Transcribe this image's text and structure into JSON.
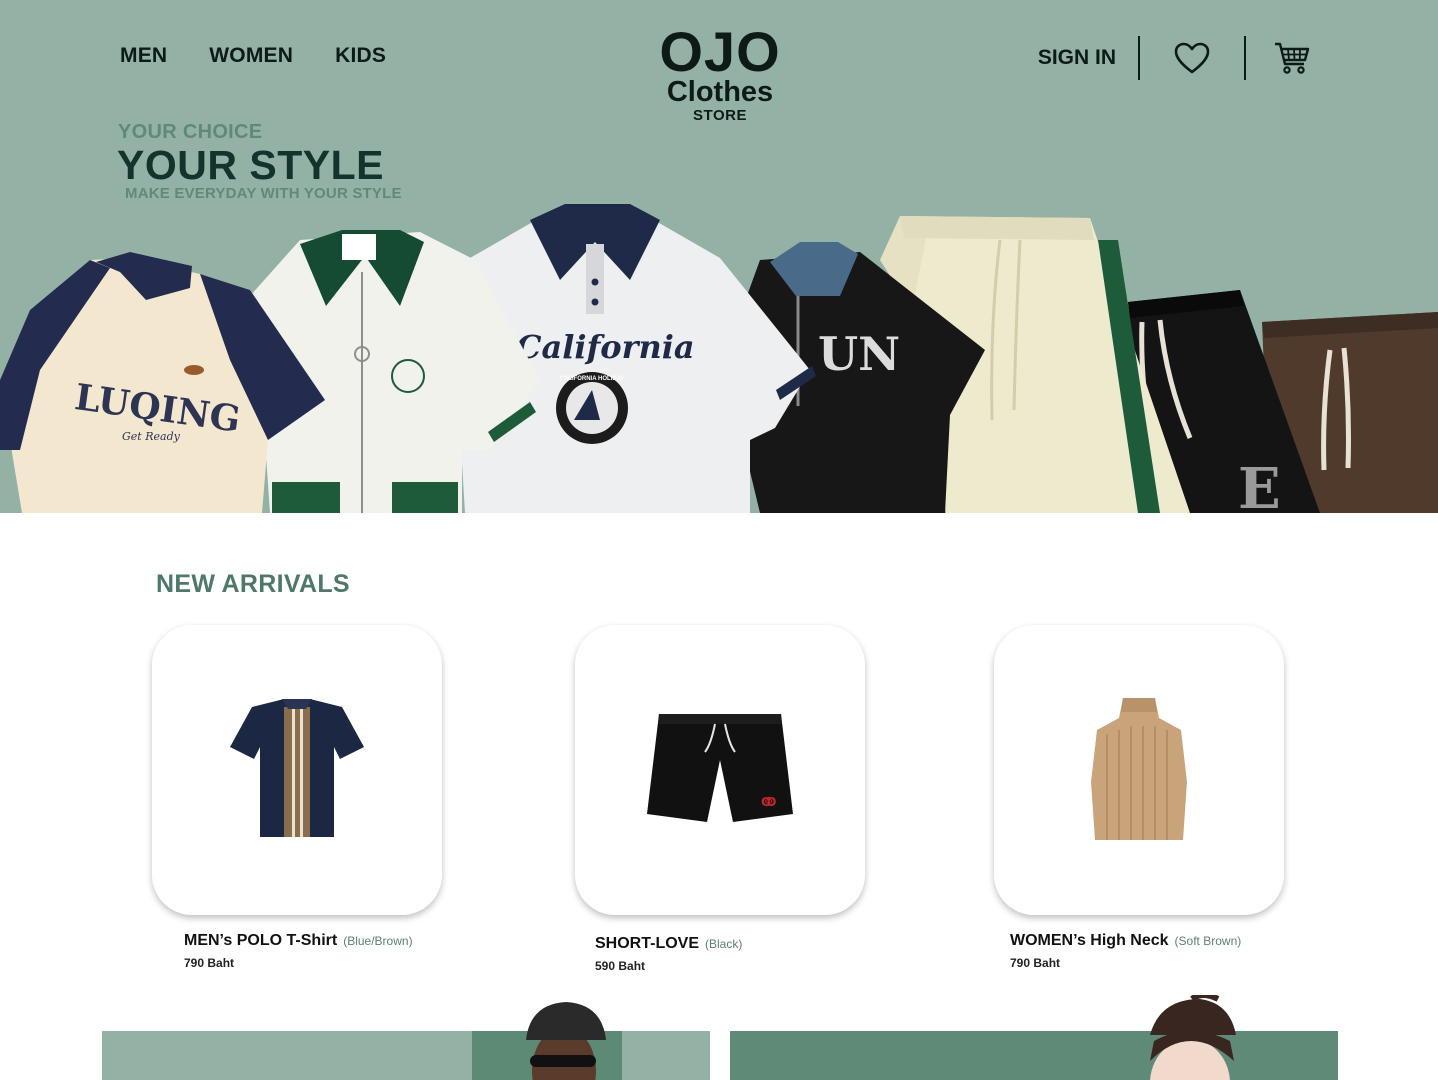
{
  "nav": {
    "links": [
      "MEN",
      "WOMEN",
      "KIDS"
    ],
    "sign_in": "SIGN IN"
  },
  "logo": {
    "line1": "OJO",
    "line2": "Clothes",
    "line3": "STORE"
  },
  "hero": {
    "tagline_small": "YOUR CHOICE",
    "tagline_big": "YOUR STYLE",
    "tagline_sub": "MAKE EVERYDAY WITH YOUR STYLE",
    "shirt_prints": [
      "LUQING",
      "Get Ready",
      "California",
      "CALIFORNIA HOLIDAY",
      "UN",
      "E"
    ]
  },
  "new_arrivals": {
    "title": "NEW ARRIVALS",
    "products": [
      {
        "name": "MEN’s POLO T-Shirt",
        "color": "(Blue/Brown)",
        "price": "790 Baht"
      },
      {
        "name": "SHORT-LOVE",
        "color": "(Black)",
        "price": "590 Baht"
      },
      {
        "name": "WOMEN’s High Neck",
        "color": "(Soft Brown)",
        "price": "790 Baht"
      }
    ]
  },
  "colors": {
    "hero_bg": "#94b1a6",
    "accent_dark": "#14332c",
    "accent_mid": "#5f8a7a"
  },
  "icons": [
    "heart-icon",
    "cart-icon"
  ]
}
